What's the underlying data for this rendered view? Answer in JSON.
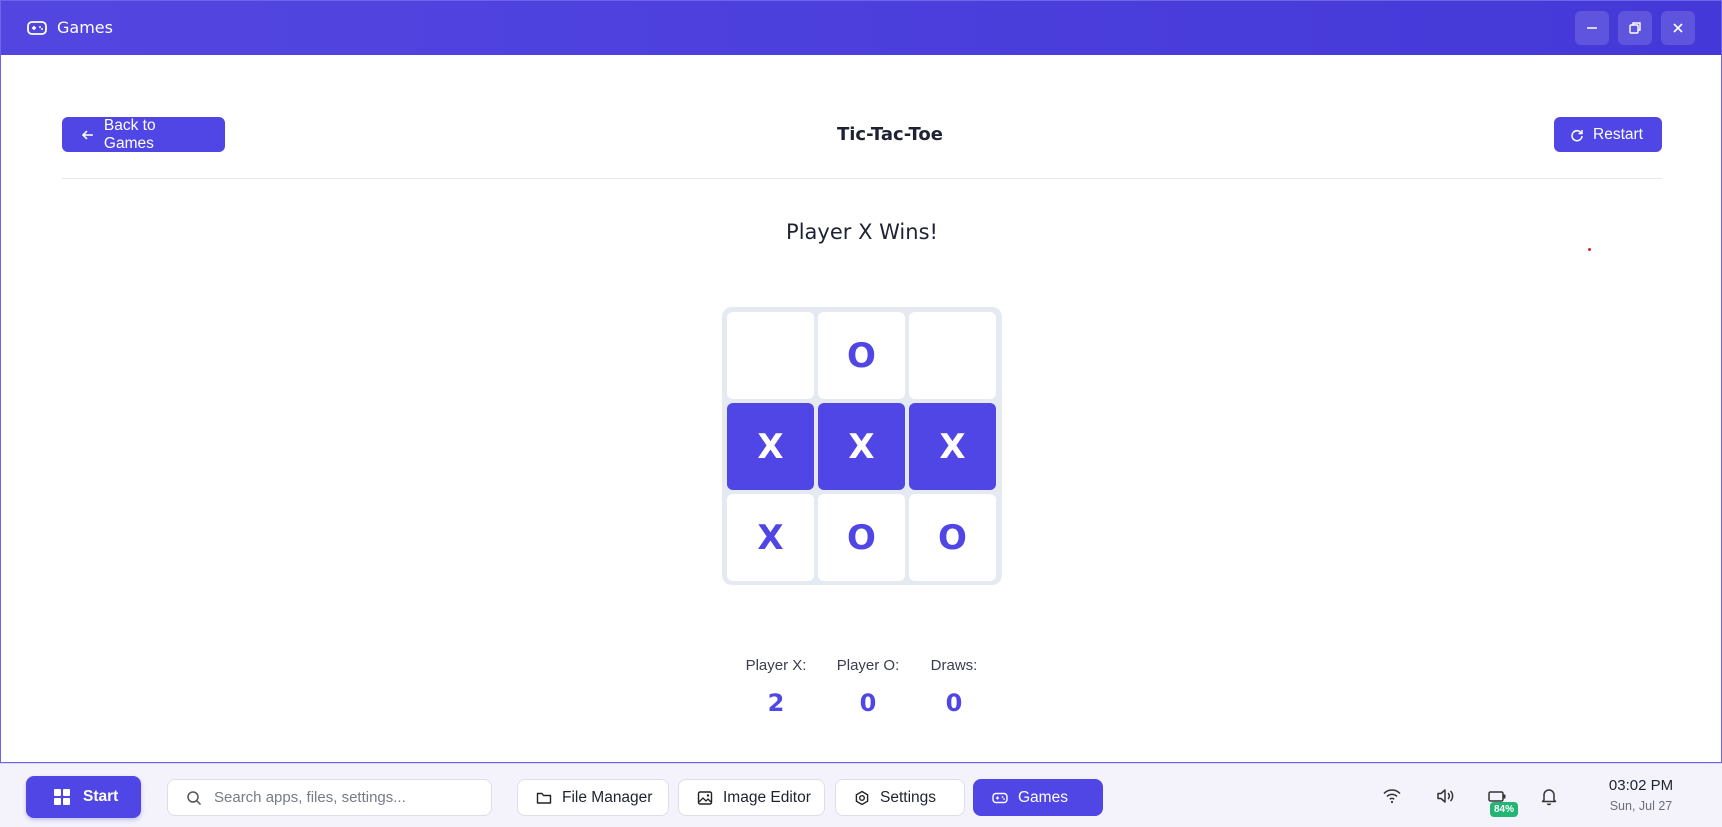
{
  "window": {
    "title": "Games",
    "app_icon": "gamepad-icon",
    "controls": [
      "minimize-icon",
      "restore-icon",
      "close-icon"
    ]
  },
  "game": {
    "back_label": "Back to Games",
    "title": "Tic-Tac-Toe",
    "restart_label": "Restart",
    "status": "Player X Wins!",
    "board": [
      "",
      "O",
      "",
      "X",
      "X",
      "X",
      "X",
      "O",
      "O"
    ],
    "winning_cells": [
      3,
      4,
      5
    ]
  },
  "scores": {
    "x_label": "Player X:",
    "x_value": "2",
    "o_label": "Player O:",
    "o_value": "0",
    "draws_label": "Draws:",
    "draws_value": "0"
  },
  "taskbar": {
    "start_label": "Start",
    "search_placeholder": "Search apps, files, settings...",
    "apps": [
      {
        "label": "File Manager",
        "icon": "folder-icon"
      },
      {
        "label": "Image Editor",
        "icon": "image-icon"
      },
      {
        "label": "Settings",
        "icon": "gear-icon"
      },
      {
        "label": "Games",
        "icon": "gamepad-icon",
        "active": true
      }
    ],
    "battery": "84%",
    "time": "03:02 PM",
    "date": "Sun, Jul 27"
  },
  "colors": {
    "accent": "#4f46e5",
    "battery_badge": "#22b573"
  }
}
